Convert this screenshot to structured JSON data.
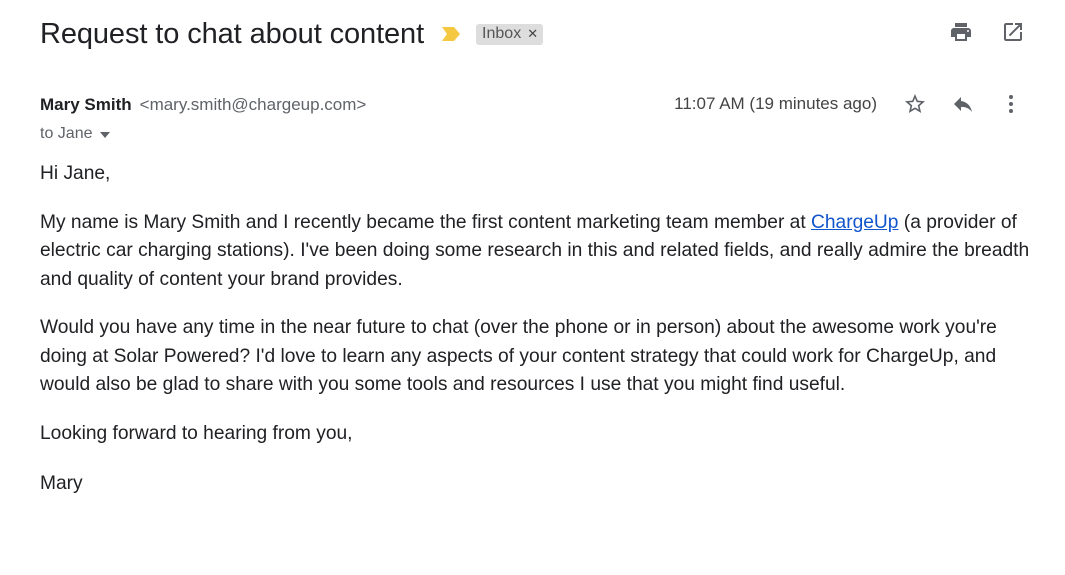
{
  "email": {
    "subject": "Request to chat about content",
    "label_badge": "Inbox",
    "label_remove_icon": "close-icon",
    "sender": {
      "name": "Mary Smith",
      "email": "<mary.smith@chargeup.com>"
    },
    "timestamp": "11:07 AM (19 minutes ago)",
    "recipient": "to Jane",
    "body": {
      "greeting": "Hi Jane,",
      "p1_before_link": "My name is Mary Smith and I recently became the first content marketing team member at ",
      "p1_link": "ChargeUp",
      "p1_after_link": " (a provider of electric car charging stations). I've been doing some research in this and related fields, and really admire the breadth and quality of content your brand provides.",
      "p2": "Would you have any time in the near future to chat (over the phone or in person) about the awesome work you're doing at Solar Powered? I'd love to learn any aspects of your content strategy that could work for ChargeUp, and would also be glad to share with you some tools and resources I use that you might find useful.",
      "closing": "Looking forward to hearing from you,",
      "signature": "Mary"
    }
  },
  "icons": {
    "importance": "importance-marker-icon",
    "print": "print-icon",
    "open_new_window": "open-in-new-window-icon",
    "star": "star-icon",
    "reply": "reply-icon",
    "more": "more-vertical-icon",
    "recipient_details": "caret-down-icon"
  },
  "colors": {
    "importance_marker": "#f5c842",
    "link": "#1155cc",
    "badge_bg": "#dddddd"
  }
}
